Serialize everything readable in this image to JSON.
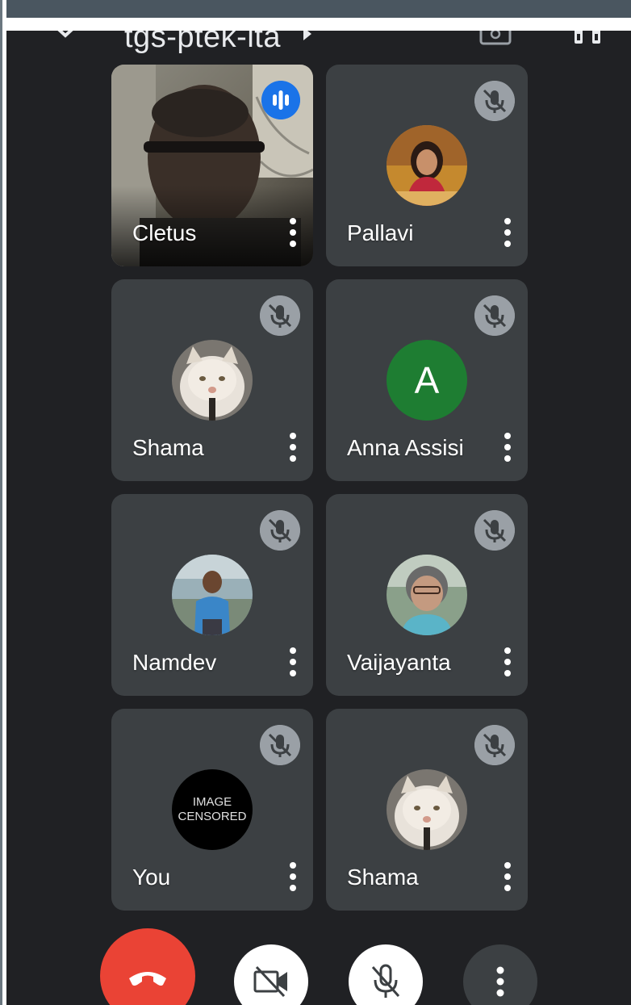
{
  "meeting": {
    "code": "tgs-ptek-ita"
  },
  "header": {
    "back_icon": "chevron-down-icon",
    "info_icon": "play-arrow-icon",
    "switch_camera_icon": "switch-camera-icon",
    "audio_icon": "audio-output-icon"
  },
  "participants": [
    {
      "name": "Cletus",
      "state": "speaking",
      "media": "video"
    },
    {
      "name": "Pallavi",
      "state": "muted",
      "media": "photo-avatar"
    },
    {
      "name": "Shama",
      "state": "muted",
      "media": "photo-avatar"
    },
    {
      "name": "Anna Assisi",
      "state": "muted",
      "media": "letter-avatar",
      "initial": "A"
    },
    {
      "name": "Namdev",
      "state": "muted",
      "media": "photo-avatar"
    },
    {
      "name": "Vaijayanta",
      "state": "muted",
      "media": "photo-avatar"
    },
    {
      "name": "You",
      "state": "muted",
      "media": "censored-avatar",
      "overlay_line1": "IMAGE",
      "overlay_line2": "CENSORED"
    },
    {
      "name": "Shama",
      "state": "muted",
      "media": "photo-avatar"
    }
  ],
  "controls": {
    "end_call_icon": "phone-hangup-icon",
    "camera_icon": "videocam-off-icon",
    "mic_icon": "mic-off-icon",
    "more_icon": "more-vert-icon"
  },
  "colors": {
    "background": "#202124",
    "tile": "#3c4043",
    "speaking": "#1a73e8",
    "end_call": "#ea4335",
    "letter_avatar": "#1e7d32"
  }
}
